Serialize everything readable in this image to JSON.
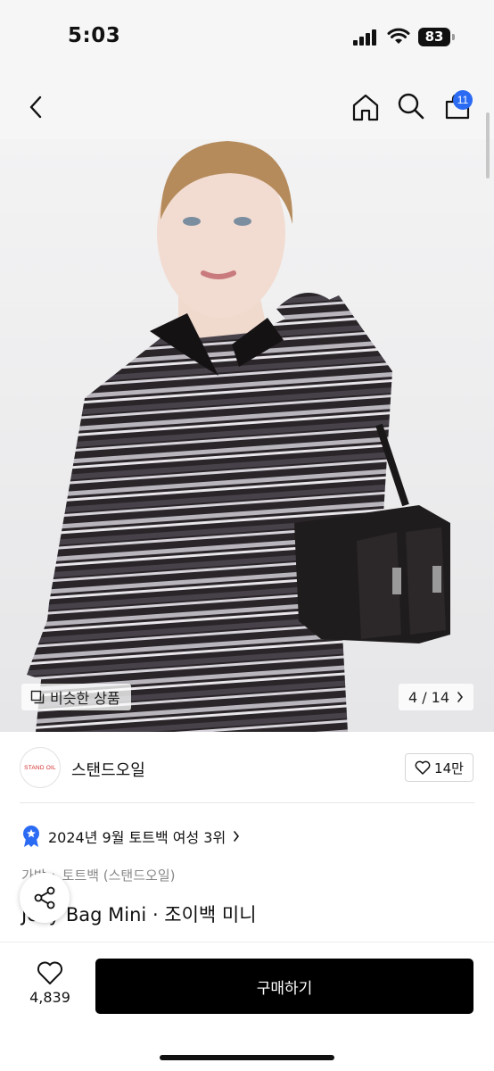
{
  "status": {
    "time": "5:03",
    "battery": "83"
  },
  "nav": {
    "cart_count": "11",
    "icons": [
      "back-chevron-icon",
      "home-icon",
      "search-icon",
      "shopping-bag-icon"
    ]
  },
  "hero": {
    "similar_label": "비슷한 상품",
    "counter": "4 / 14"
  },
  "brand": {
    "logo_text": "STAND OIL",
    "name": "스탠드오일",
    "likes": "14만"
  },
  "ranking": {
    "text": "2024년 9월 토트백 여성 3위"
  },
  "breadcrumb": {
    "cat1": "가방",
    "sep": "›",
    "cat2": "토트백 (스탠드오일)"
  },
  "product": {
    "title": "Jelly Bag Mini · 조이백 미니"
  },
  "bottom": {
    "likes": "4,839",
    "buy_label": "구매하기"
  },
  "colors": {
    "accent": "#2b6bf3",
    "buy_button": "#000000",
    "brand_logo": "#d42a2a"
  }
}
